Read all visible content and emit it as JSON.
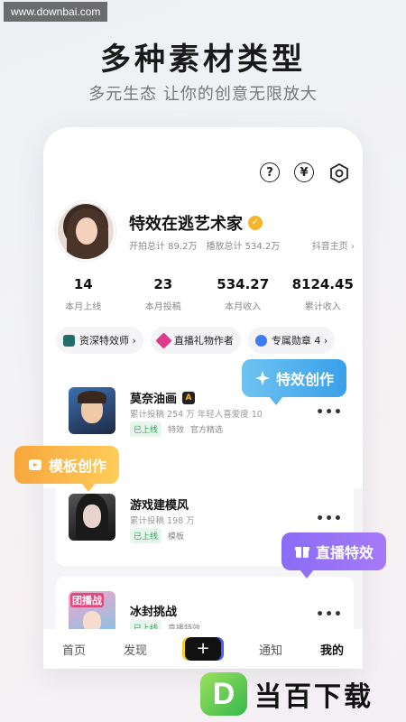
{
  "watermark_top": "www.downbai.com",
  "hero": {
    "title": "多种素材类型",
    "subtitle": "多元生态 让你的创意无限放大"
  },
  "top_icons": {
    "help": "?",
    "currency": "¥"
  },
  "profile": {
    "name": "特效在逃艺术家",
    "total_shoot": "开拍总计 89.2万",
    "total_play": "播放总计 534.2万",
    "homepage_link": "抖音主页 ›"
  },
  "metrics": [
    {
      "value": "14",
      "label": "本月上线"
    },
    {
      "value": "23",
      "label": "本月投稿"
    },
    {
      "value": "534.27",
      "label": "本月收入"
    },
    {
      "value": "8124.45",
      "label": "累计收入"
    }
  ],
  "badges": [
    {
      "label": "资深特效师 ›",
      "color": "#1f6e6a"
    },
    {
      "label": "直播礼物作者",
      "color": "#e03a8c"
    },
    {
      "label": "专属勋章 4 ›",
      "color": "#3e7ef0"
    }
  ],
  "works": [
    {
      "title": "莫奈油画",
      "badge": "A",
      "meta": "累计投稿 254 万    年轻人喜爱度 10",
      "status": "已上线",
      "type": "特效",
      "extra": "官方精选"
    },
    {
      "title": "游戏建模风",
      "meta": "累计投稿 198 万",
      "status": "已上线",
      "type": "模板",
      "extra": ""
    },
    {
      "title": "冰封挑战",
      "meta": "",
      "status": "已上线",
      "type": "直播特效",
      "extra": "",
      "thumb_text": "团播战"
    }
  ],
  "more_label": "•••",
  "bubbles": {
    "effect": "特效创作",
    "template": "模板创作",
    "live": "直播特效"
  },
  "nav": {
    "home": "首页",
    "discover": "发现",
    "plus": "+",
    "notify": "通知",
    "mine": "我的"
  },
  "logo": {
    "letter": "D",
    "text": "当百下载"
  }
}
